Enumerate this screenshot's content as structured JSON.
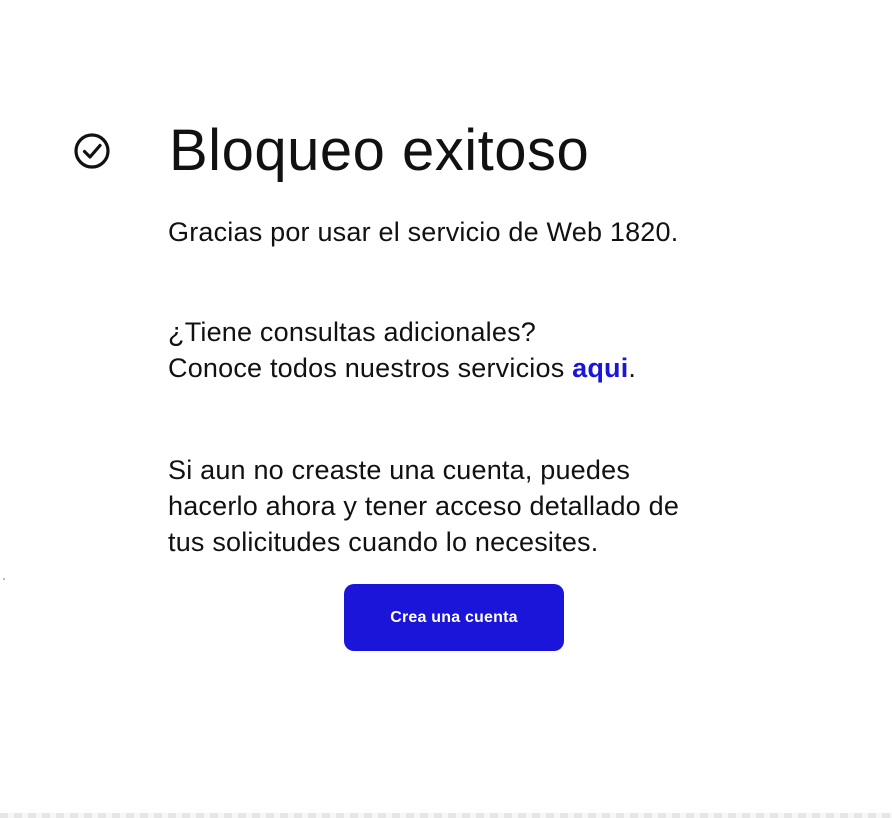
{
  "status": {
    "icon": "check-circle-icon",
    "title": "Bloqueo exitoso"
  },
  "message": {
    "thanks": "Gracias por usar el servicio de Web 1820."
  },
  "consult": {
    "question": "¿Tiene consultas adicionales?",
    "prefix": "Conoce todos nuestros servicios ",
    "link_label": "aqui",
    "suffix": "."
  },
  "account": {
    "lines": [
      "Si aun no creaste una cuenta, puedes",
      "hacerlo ahora y tener acceso detallado de",
      "tus solicitudes cuando lo necesites."
    ],
    "button_label": "Crea una cuenta"
  },
  "colors": {
    "accent": "#1a15d8",
    "text": "#111111",
    "background": "#ffffff"
  }
}
